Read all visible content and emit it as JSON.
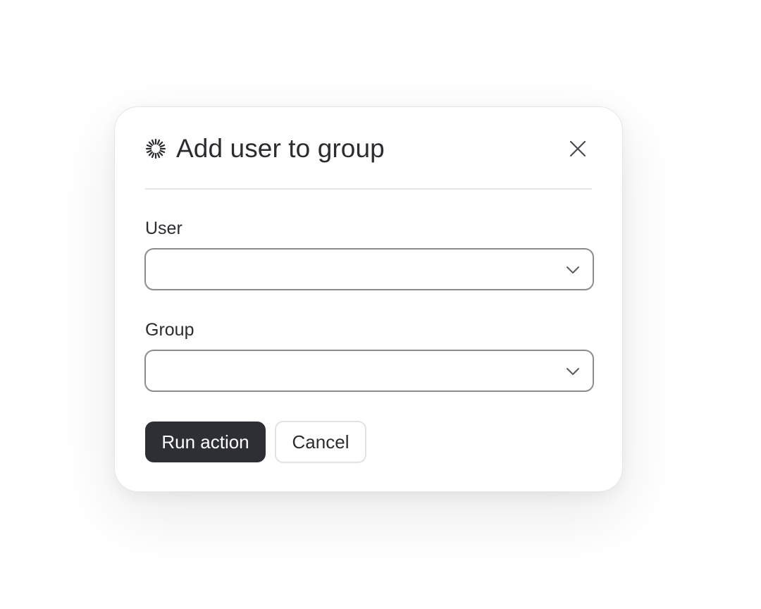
{
  "dialog": {
    "title": "Add user to group",
    "icon": "spinner-icon",
    "close_icon": "close-icon"
  },
  "fields": [
    {
      "label": "User",
      "value": "",
      "icon": "chevron-down-icon"
    },
    {
      "label": "Group",
      "value": "",
      "icon": "chevron-down-icon"
    }
  ],
  "actions": {
    "run_label": "Run action",
    "cancel_label": "Cancel"
  },
  "colors": {
    "primary_button": "#2e2f34",
    "text": "#2b2c30",
    "border": "#8c8c90"
  }
}
